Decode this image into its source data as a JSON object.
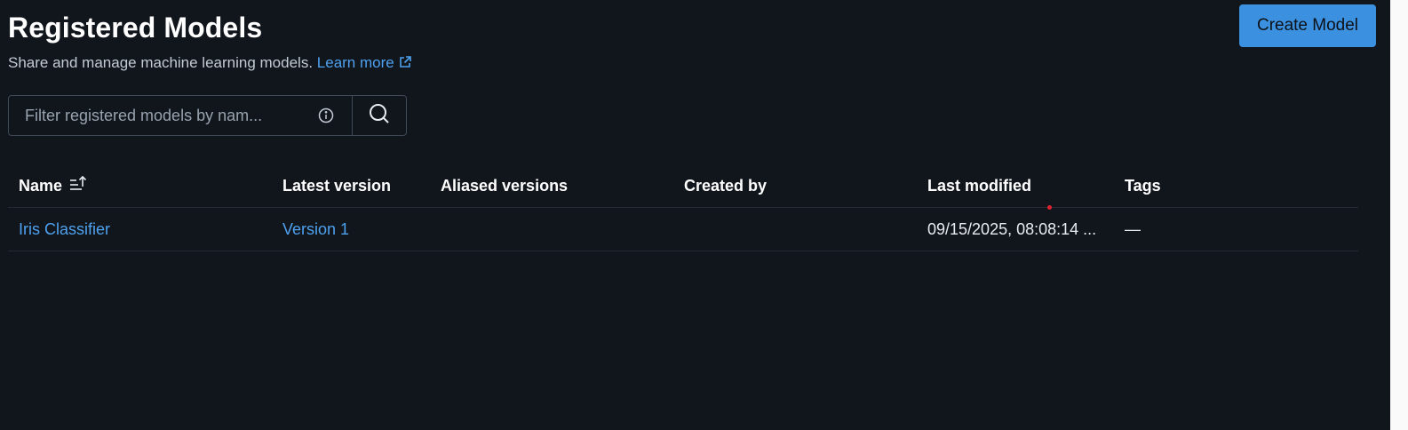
{
  "header": {
    "title": "Registered Models",
    "subtitle": "Share and manage machine learning models.",
    "learn_more": "Learn more",
    "create_button": "Create Model"
  },
  "search": {
    "placeholder": "Filter registered models by nam...",
    "value": ""
  },
  "icons": {
    "external_link": "external-link-icon",
    "info": "info-icon",
    "search": "search-icon",
    "sort": "sort-ascending-icon"
  },
  "colors": {
    "background": "#11161d",
    "accent": "#3b91e0",
    "link": "#4ea1ee"
  },
  "table": {
    "columns": [
      "Name",
      "Latest version",
      "Aliased versions",
      "Created by",
      "Last modified",
      "Tags"
    ],
    "rows": [
      {
        "name": "Iris Classifier",
        "latest_version": "Version 1",
        "aliased_versions": "",
        "created_by": "",
        "last_modified": "09/15/2025, 08:08:14 ...",
        "tags": "—"
      }
    ]
  }
}
